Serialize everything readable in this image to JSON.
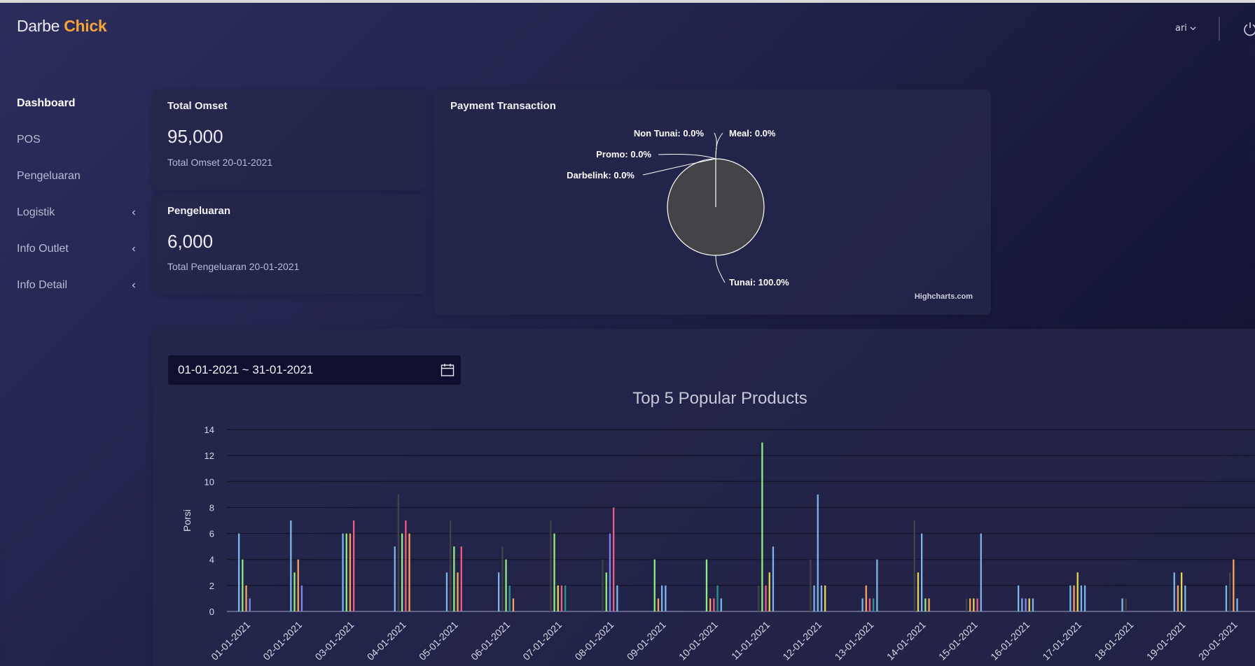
{
  "brand": {
    "name": "Darbe",
    "accent": "Chick"
  },
  "header": {
    "user": "ari",
    "icons": [
      "chevron-down-icon",
      "power-icon"
    ]
  },
  "sidebar": {
    "items": [
      {
        "label": "Dashboard",
        "active": true,
        "has_submenu": false
      },
      {
        "label": "POS",
        "active": false,
        "has_submenu": false
      },
      {
        "label": "Pengeluaran",
        "active": false,
        "has_submenu": false
      },
      {
        "label": "Logistik",
        "active": false,
        "has_submenu": true
      },
      {
        "label": "Info Outlet",
        "active": false,
        "has_submenu": true
      },
      {
        "label": "Info Detail",
        "active": false,
        "has_submenu": true
      }
    ]
  },
  "cards": {
    "omset": {
      "title": "Total Omset",
      "value": "95,000",
      "subtitle": "Total Omset 20-01-2021"
    },
    "pengeluaran": {
      "title": "Pengeluaran",
      "value": "6,000",
      "subtitle": "Total Pengeluaran 20-01-2021"
    }
  },
  "payment": {
    "title": "Payment Transaction",
    "credit": "Highcharts.com"
  },
  "date_range": {
    "value": "01-01-2021 ~ 31-01-2021",
    "icon": "calendar-icon"
  },
  "colors": {
    "accent": "#f5a43a",
    "series": [
      "#7cb5ec",
      "#434348",
      "#90ed7d",
      "#f7a35c",
      "#8085e9",
      "#f15c80",
      "#e4d354",
      "#2b908f"
    ]
  },
  "chart_data": [
    {
      "type": "pie",
      "title": "Payment Transaction",
      "slices": [
        {
          "name": "Tunai",
          "value": 100.0,
          "label": "Tunai: 100.0%"
        },
        {
          "name": "Non Tunai",
          "value": 0.0,
          "label": "Non Tunai: 0.0%"
        },
        {
          "name": "Meal",
          "value": 0.0,
          "label": "Meal: 0.0%"
        },
        {
          "name": "Promo",
          "value": 0.0,
          "label": "Promo: 0.0%"
        },
        {
          "name": "Darbelink",
          "value": 0.0,
          "label": "Darbelink: 0.0%"
        }
      ]
    },
    {
      "type": "bar",
      "title": "Top 5 Popular Products",
      "ylabel": "Porsi",
      "xlabel": "",
      "ylim": [
        0,
        14
      ],
      "yticks": [
        0,
        2,
        4,
        6,
        8,
        10,
        12,
        14
      ],
      "grid": true,
      "categories": [
        "01-01-2021",
        "02-01-2021",
        "03-01-2021",
        "04-01-2021",
        "05-01-2021",
        "06-01-2021",
        "07-01-2021",
        "08-01-2021",
        "09-01-2021",
        "10-01-2021",
        "11-01-2021",
        "12-01-2021",
        "13-01-2021",
        "14-01-2021",
        "15-01-2021",
        "16-01-2021",
        "17-01-2021",
        "18-01-2021",
        "19-01-2021",
        "20-01-2021"
      ],
      "bars": [
        [
          [
            0,
            6
          ],
          [
            2,
            4
          ],
          [
            3,
            2
          ],
          [
            4,
            1
          ]
        ],
        [
          [
            0,
            7
          ],
          [
            2,
            3
          ],
          [
            3,
            4
          ],
          [
            4,
            2
          ]
        ],
        [
          [
            0,
            6
          ],
          [
            2,
            6
          ],
          [
            3,
            6
          ],
          [
            5,
            7
          ]
        ],
        [
          [
            0,
            5
          ],
          [
            1,
            9
          ],
          [
            2,
            6
          ],
          [
            5,
            7
          ],
          [
            3,
            6
          ]
        ],
        [
          [
            0,
            3
          ],
          [
            1,
            7
          ],
          [
            2,
            5
          ],
          [
            3,
            3
          ],
          [
            5,
            5
          ]
        ],
        [
          [
            0,
            3
          ],
          [
            1,
            5
          ],
          [
            2,
            4
          ],
          [
            7,
            2
          ],
          [
            3,
            1
          ]
        ],
        [
          [
            1,
            7
          ],
          [
            2,
            6
          ],
          [
            6,
            2
          ],
          [
            5,
            2
          ],
          [
            7,
            2
          ]
        ],
        [
          [
            1,
            4
          ],
          [
            2,
            3
          ],
          [
            4,
            6
          ],
          [
            5,
            8
          ],
          [
            0,
            2
          ]
        ],
        [
          [
            2,
            4
          ],
          [
            3,
            1
          ],
          [
            0,
            2
          ],
          [
            0,
            2
          ]
        ],
        [
          [
            2,
            4
          ],
          [
            3,
            1
          ],
          [
            5,
            1
          ],
          [
            7,
            2
          ],
          [
            0,
            1
          ]
        ],
        [
          [
            1,
            2
          ],
          [
            2,
            13
          ],
          [
            5,
            2
          ],
          [
            6,
            3
          ],
          [
            0,
            5
          ]
        ],
        [
          [
            1,
            4
          ],
          [
            0,
            2
          ],
          [
            0,
            9
          ],
          [
            0,
            2
          ],
          [
            6,
            2
          ]
        ],
        [
          [
            0,
            1
          ],
          [
            3,
            2
          ],
          [
            5,
            1
          ],
          [
            7,
            1
          ],
          [
            0,
            4
          ]
        ],
        [
          [
            1,
            7
          ],
          [
            6,
            3
          ],
          [
            0,
            6
          ],
          [
            2,
            1
          ],
          [
            3,
            1
          ]
        ],
        [
          [
            1,
            1
          ],
          [
            3,
            1
          ],
          [
            6,
            1
          ],
          [
            5,
            1
          ],
          [
            0,
            6
          ]
        ],
        [
          [
            0,
            2
          ],
          [
            0,
            1
          ],
          [
            4,
            1
          ],
          [
            6,
            1
          ],
          [
            0,
            1
          ]
        ],
        [
          [
            0,
            2
          ],
          [
            3,
            2
          ],
          [
            6,
            3
          ],
          [
            0,
            2
          ],
          [
            0,
            2
          ]
        ],
        [
          [
            0,
            1
          ],
          [
            1,
            1
          ]
        ],
        [
          [
            0,
            3
          ],
          [
            3,
            2
          ],
          [
            6,
            3
          ],
          [
            0,
            2
          ]
        ],
        [
          [
            0,
            2
          ],
          [
            1,
            3
          ],
          [
            3,
            4
          ],
          [
            0,
            1
          ]
        ]
      ]
    }
  ]
}
